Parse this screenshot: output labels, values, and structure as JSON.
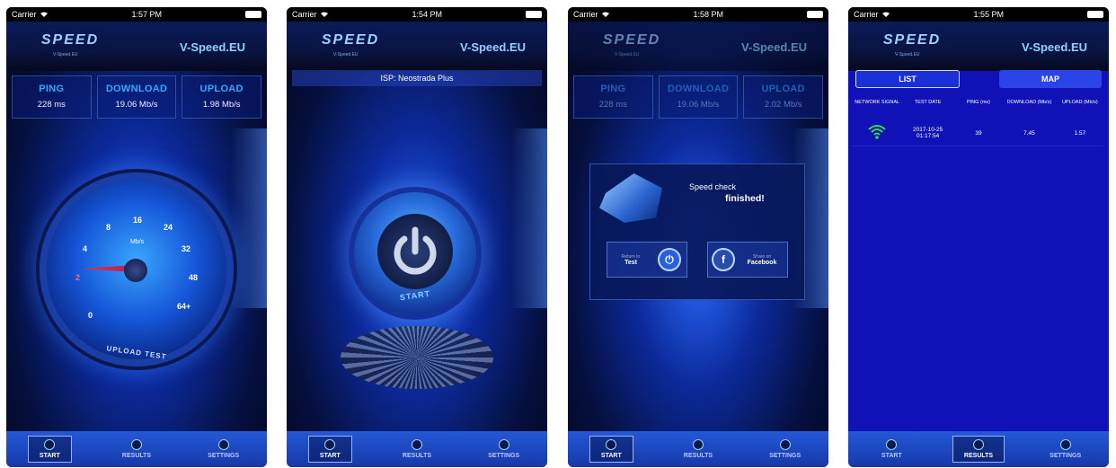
{
  "status": {
    "carrier": "Carrier"
  },
  "brand": {
    "logo": "SPEED",
    "logo_sub": "V-Speed.EU",
    "name": "V-Speed.EU"
  },
  "screens": [
    {
      "time": "1:57 PM",
      "ping_label": "PING",
      "ping": "228 ms",
      "download_label": "DOWNLOAD",
      "download": "19.06 Mb/s",
      "upload_label": "UPLOAD",
      "upload": "1.98 Mb/s",
      "gauge": {
        "unit": "Mb/s",
        "ticks": [
          "0",
          "2",
          "4",
          "8",
          "16",
          "24",
          "32",
          "48",
          "64+"
        ],
        "caption": "UPLOAD TEST"
      }
    },
    {
      "time": "1:54 PM",
      "isp": "ISP: Neostrada Plus",
      "power_label": "START"
    },
    {
      "time": "1:58 PM",
      "ping_label": "PING",
      "ping": "228 ms",
      "download_label": "DOWNLOAD",
      "download": "19.06 Mb/s",
      "upload_label": "UPLOAD",
      "upload": "2.02 Mb/s",
      "dialog": {
        "line1": "Speed check",
        "line2": "finished!",
        "return_small": "Return to",
        "return_big": "Test",
        "fb_small": "Share on",
        "fb_big": "Facebook"
      }
    },
    {
      "time": "1:55 PM",
      "tab_list": "LIST",
      "tab_map": "MAP",
      "columns": [
        "NETWORK SIGNAL",
        "TEST DATE",
        "PING (ms)",
        "DOWNLOAD (Mb/s)",
        "UPLOAD (Mb/s)"
      ],
      "row": {
        "date": "2017-10-25",
        "time": "01:17:54",
        "ping": "39",
        "download": "7.45",
        "upload": "1.57"
      }
    }
  ],
  "tabs": [
    "START",
    "RESULTS",
    "SETTINGS"
  ]
}
